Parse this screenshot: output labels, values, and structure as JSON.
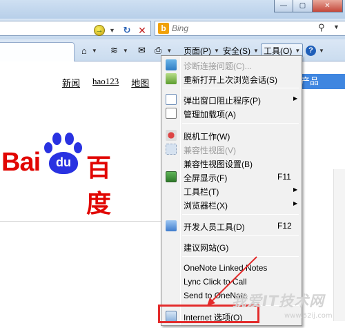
{
  "window": {
    "minimize_glyph": "—",
    "maximize_glyph": "▢",
    "close_glyph": "✕"
  },
  "address_bar": {
    "go_glyph": "→",
    "refresh_glyph": "↻",
    "stop_glyph": "✕"
  },
  "search": {
    "provider_glyph": "b",
    "placeholder": "Bing",
    "search_glyph": "⚲",
    "dropdown_glyph": "▼"
  },
  "command_bar": {
    "home_glyph": "⌂",
    "feeds_glyph": "≋",
    "mail_glyph": "✉",
    "print_glyph": "⎙",
    "page_label": "页面(P)",
    "safety_label": "安全(S)",
    "tools_label": "工具(O)",
    "help_glyph": "?",
    "arrow_glyph": "▼"
  },
  "page": {
    "nav_links": [
      "新闻",
      "hao123",
      "地图"
    ],
    "product_button": "产品",
    "logo": {
      "latin_text": "Bai",
      "paw_text": "du",
      "chinese_text": "百度"
    }
  },
  "tools_menu": {
    "items": [
      {
        "label": "诊断连接问题(C)...",
        "shortcut": "",
        "submenu": false,
        "disabled": true
      },
      {
        "label": "重新打开上次浏览会话(S)",
        "shortcut": "",
        "submenu": false,
        "disabled": false
      },
      {
        "label": "弹出窗口阻止程序(P)",
        "shortcut": "",
        "submenu": true,
        "disabled": false
      },
      {
        "label": "管理加载项(A)",
        "shortcut": "",
        "submenu": false,
        "disabled": false
      },
      {
        "label": "脱机工作(W)",
        "shortcut": "",
        "submenu": false,
        "disabled": false
      },
      {
        "label": "兼容性视图(V)",
        "shortcut": "",
        "submenu": false,
        "disabled": true
      },
      {
        "label": "兼容性视图设置(B)",
        "shortcut": "",
        "submenu": false,
        "disabled": false
      },
      {
        "label": "全屏显示(F)",
        "shortcut": "F11",
        "submenu": false,
        "disabled": false
      },
      {
        "label": "工具栏(T)",
        "shortcut": "",
        "submenu": true,
        "disabled": false
      },
      {
        "label": "浏览器栏(X)",
        "shortcut": "",
        "submenu": true,
        "disabled": false
      },
      {
        "label": "开发人员工具(D)",
        "shortcut": "F12",
        "submenu": false,
        "disabled": false
      },
      {
        "label": "建议网站(G)",
        "shortcut": "",
        "submenu": false,
        "disabled": false
      },
      {
        "label": "OneNote Linked Notes",
        "shortcut": "",
        "submenu": false,
        "disabled": false
      },
      {
        "label": "Lync Click to Call",
        "shortcut": "",
        "submenu": false,
        "disabled": false
      },
      {
        "label": "Send to OneNote",
        "shortcut": "",
        "submenu": false,
        "disabled": false
      },
      {
        "label": "Internet 选项(O)",
        "shortcut": "",
        "submenu": false,
        "disabled": false
      }
    ],
    "submenu_glyph": "▶"
  },
  "watermark": {
    "main": "我爱IT技术网",
    "sub": "www.52ij.com"
  },
  "colors": {
    "annotation_red": "#e32b2b",
    "baidu_red": "#e10602",
    "baidu_blue": "#2932e1"
  }
}
